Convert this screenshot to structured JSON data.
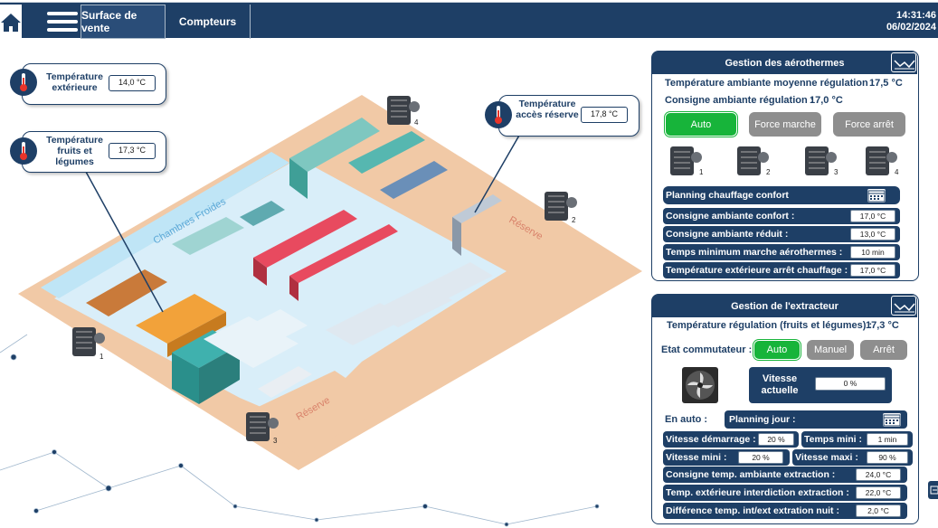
{
  "header": {
    "tabs": [
      "Surface de vente",
      "Compteurs"
    ],
    "time": "14:31:46",
    "date": "06/02/2024"
  },
  "icons": {
    "home": "home-icon",
    "menu": "menu-icon",
    "thermometer": "thermometer-icon",
    "heater": "heater-icon",
    "fan": "fan-icon",
    "calendar": "calendar-icon",
    "trend": "trend-icon",
    "side": "side-panel-icon"
  },
  "colors": {
    "navy": "#1e3f66",
    "green": "#17b43a",
    "grey": "#8e8e8e"
  },
  "sensors": {
    "ext": {
      "label": "Température extérieure",
      "value": "14,0 °C"
    },
    "fruits": {
      "label": "Température fruits et légumes",
      "value": "17,3 °C"
    },
    "reserve": {
      "label": "Température accès réserve",
      "value": "17,8 °C"
    }
  },
  "map": {
    "chambres": "Chambres Froides",
    "reserve1": "Réserve",
    "reserve2": "Réserve",
    "h1": "1",
    "h2": "2",
    "h3": "3",
    "h4": "4"
  },
  "aero": {
    "title": "Gestion des aérothermes",
    "avg_label": "Température ambiante moyenne régulation :",
    "avg_value": "17,5 °C",
    "set_label": "Consigne ambiante régulation :",
    "set_value": "17,0 °C",
    "buttons": [
      "Auto",
      "Force marche",
      "Force arrêt"
    ],
    "units": [
      "1",
      "2",
      "3",
      "4"
    ],
    "planning": "Planning chauffage confort",
    "rows": [
      {
        "label": "Consigne ambiante confort :",
        "value": "17,0 °C"
      },
      {
        "label": "Consigne ambiante réduit :",
        "value": "13,0 °C"
      },
      {
        "label": "Temps minimum marche aérothermes :",
        "value": "10 min"
      },
      {
        "label": "Température extérieure arrêt chauffage :",
        "value": "17,0 °C"
      }
    ]
  },
  "extr": {
    "title": "Gestion de l'extracteur",
    "reg_label": "Température régulation (fruits et légumes) :",
    "reg_value": "17,3 °C",
    "etat_label": "Etat commutateur :",
    "buttons": [
      "Auto",
      "Manuel",
      "Arrêt"
    ],
    "speed_label": "Vitesse actuelle",
    "speed_value": "0 %",
    "en_auto": "En auto :",
    "planning": "Planning jour :",
    "vd_label": "Vitesse démarrage :",
    "vd_value": "20 %",
    "tm_label": "Temps mini :",
    "tm_value": "1 min",
    "vmin_label": "Vitesse mini :",
    "vmin_value": "20 %",
    "vmax_label": "Vitesse maxi :",
    "vmax_value": "90 %",
    "rows": [
      {
        "label": "Consigne temp. ambiante extraction :",
        "value": "24,0 °C"
      },
      {
        "label": "Temp. extérieure interdiction extraction :",
        "value": "22,0 °C"
      },
      {
        "label": "Différence temp. int/ext extration nuit :",
        "value": "2,0 °C"
      }
    ]
  }
}
